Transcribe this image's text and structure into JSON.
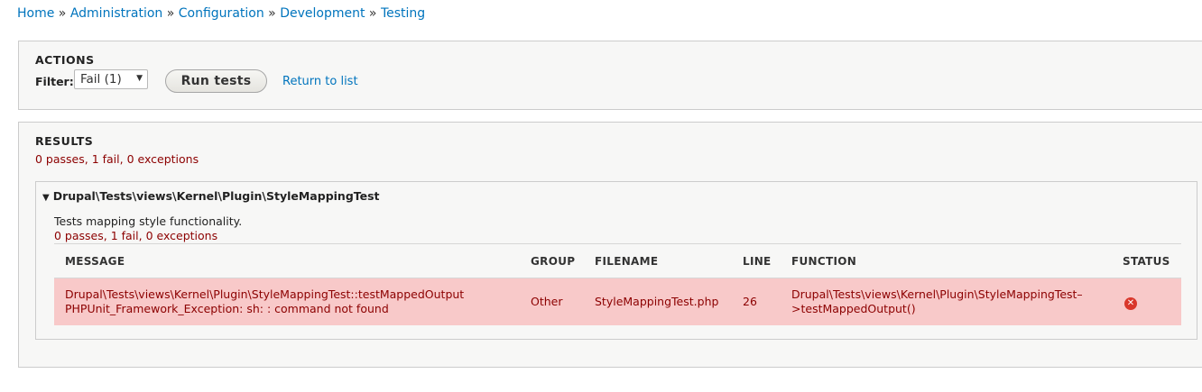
{
  "breadcrumb": {
    "items": [
      "Home",
      "Administration",
      "Configuration",
      "Development",
      "Testing"
    ],
    "separator": "»"
  },
  "actions": {
    "legend": "ACTIONS",
    "filter_label": "Filter:",
    "filter_value": "Fail (1)",
    "run_button": "Run tests",
    "return_link": "Return to list"
  },
  "results": {
    "legend": "RESULTS",
    "summary": "0 passes, 1 fail, 0 exceptions",
    "group": {
      "title": "Drupal\\Tests\\views\\Kernel\\Plugin\\StyleMappingTest",
      "description": "Tests mapping style functionality.",
      "summary": "0 passes, 1 fail, 0 exceptions",
      "columns": [
        "MESSAGE",
        "GROUP",
        "FILENAME",
        "LINE",
        "FUNCTION",
        "STATUS"
      ],
      "rows": [
        {
          "message_line1": "Drupal\\Tests\\views\\Kernel\\Plugin\\StyleMappingTest::testMappedOutput",
          "message_line2": "PHPUnit_Framework_Exception: sh: : command not found",
          "group": "Other",
          "filename": "StyleMappingTest.php",
          "line": "26",
          "function_line1": "Drupal\\Tests\\views\\Kernel\\Plugin\\StyleMappingTest–",
          "function_line2": ">testMappedOutput()",
          "status_icon": "error-icon"
        }
      ]
    }
  },
  "colors": {
    "link": "#0074bd",
    "fail_text": "#8c0000",
    "fail_row_bg": "#f8c9c9",
    "error_icon": "#d9372b"
  }
}
